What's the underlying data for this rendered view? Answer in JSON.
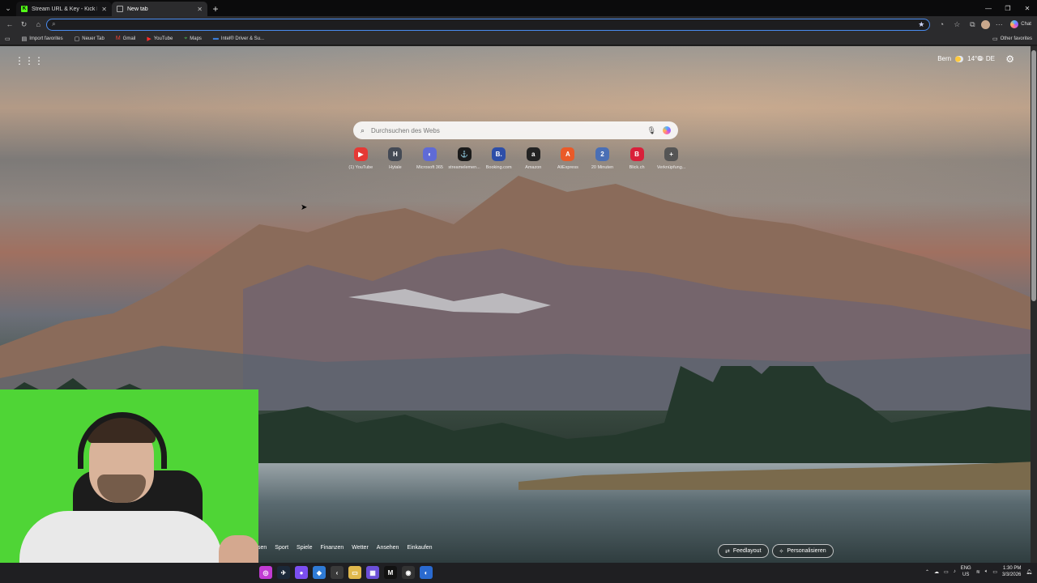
{
  "tabs": [
    {
      "label": "Stream URL & Key - Kick Dashboa",
      "close": "✕"
    },
    {
      "label": "New tab",
      "close": "✕"
    }
  ],
  "toolbar": {
    "address_value": "",
    "chat_label": "Chat"
  },
  "bookmarks": [
    {
      "icon": "▤",
      "label": "Import favorites"
    },
    {
      "icon": "▢",
      "label": "Neuer Tab"
    },
    {
      "icon": "M",
      "label": "Gmail"
    },
    {
      "icon": "▶",
      "label": "YouTube"
    },
    {
      "icon": "⌖",
      "label": "Maps"
    },
    {
      "icon": "▬",
      "label": "Intel® Driver & Su..."
    }
  ],
  "other_favorites": "Other favorites",
  "weather": {
    "city": "Bern",
    "temp": "14°C"
  },
  "language": "DE",
  "search": {
    "placeholder": "Durchsuchen des Webs"
  },
  "quicklinks": [
    {
      "label": "(1) YouTube",
      "letter": "▶",
      "color": "#e53935"
    },
    {
      "label": "Hytale",
      "letter": "H",
      "color": "#444a55"
    },
    {
      "label": "Microsoft 365",
      "letter": "◐",
      "color": "#5f6bd6"
    },
    {
      "label": "streamelemen...",
      "letter": "⚓",
      "color": "#1b1b1b"
    },
    {
      "label": "Booking.com",
      "letter": "B.",
      "color": "#2d4ea8"
    },
    {
      "label": "Amazon",
      "letter": "a",
      "color": "#232323"
    },
    {
      "label": "AliExpress",
      "letter": "A",
      "color": "#ea5a28"
    },
    {
      "label": "20 Minuten",
      "letter": "2",
      "color": "#4a6fb5"
    },
    {
      "label": "Blick.ch",
      "letter": "B",
      "color": "#d9203a"
    },
    {
      "label": "Verknüpfung...",
      "letter": "+",
      "color": "#555555"
    }
  ],
  "feed_nav": [
    "sen",
    "Sport",
    "Spiele",
    "Finanzen",
    "Wetter",
    "Ansehen",
    "Einkaufen"
  ],
  "feed_buttons": {
    "layout": "Feedlayout",
    "personalize": "Personalisieren"
  },
  "taskbar": {
    "lang_top": "ENG",
    "lang_bottom": "US",
    "time": "1:30 PM",
    "date": "3/3/2026"
  }
}
